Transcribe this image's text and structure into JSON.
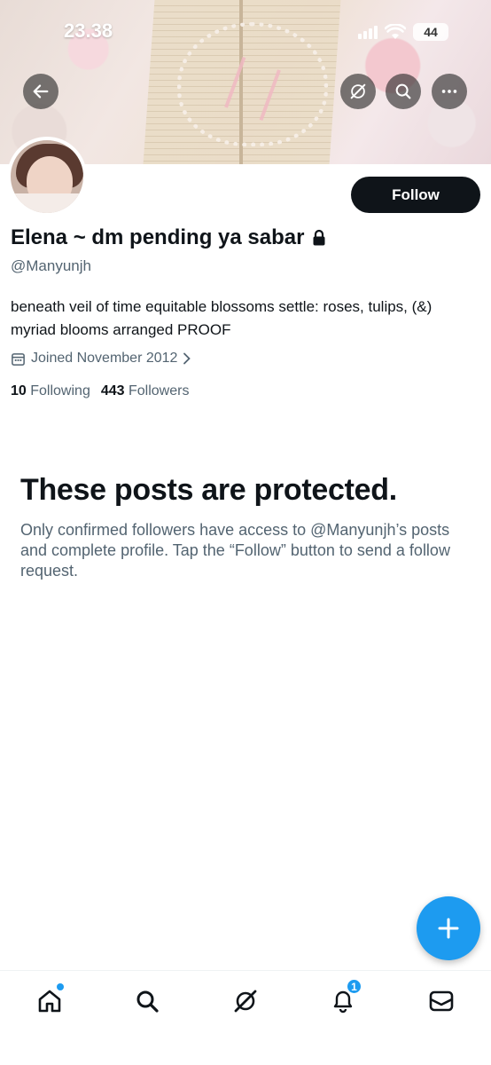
{
  "status_bar": {
    "time": "23.38",
    "battery": "44"
  },
  "profile": {
    "display_name": "Elena ~ dm pending ya sabar",
    "handle": "@Manyunjh",
    "bio": "beneath veil of time equitable blossoms settle: roses, tulips, (&) myriad blooms arranged PROOF",
    "joined": "Joined November 2012",
    "following_count": "10",
    "following_label": "Following",
    "followers_count": "443",
    "followers_label": "Followers",
    "follow_button": "Follow"
  },
  "protected": {
    "title": "These posts are protected.",
    "text": "Only confirmed followers have access to @Manyunjh’s posts and complete profile. Tap the “Follow” button to send a follow request."
  },
  "tabbar": {
    "notifications_badge": "1"
  },
  "icons": {
    "back": "back-arrow-icon",
    "grok": "grok-icon",
    "search": "search-icon",
    "more": "more-icon",
    "lock": "lock-icon",
    "calendar": "calendar-icon",
    "compose": "plus-icon",
    "home": "home-icon",
    "explore": "search-icon",
    "grok_tab": "grok-icon",
    "notifications": "bell-icon",
    "messages": "mail-icon"
  },
  "colors": {
    "accent": "#1d9bf0",
    "text": "#0f1419",
    "secondary": "#536471",
    "button": "#0f1419"
  }
}
